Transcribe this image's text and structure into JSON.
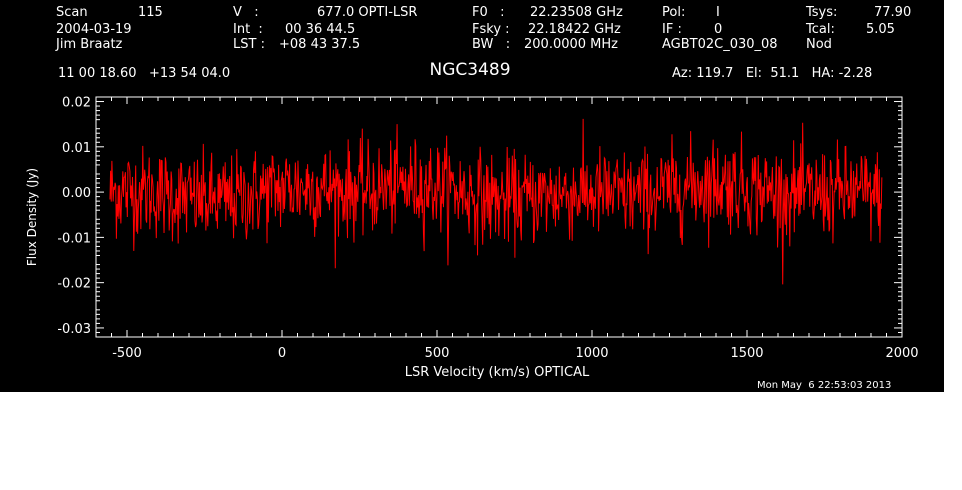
{
  "header": {
    "scan_label": "Scan",
    "scan_value": "115",
    "date": "2004-03-19",
    "observer": "Jim Braatz",
    "v_label": "V   :",
    "v_value": "677.0 OPTI-LSR",
    "int_label": "Int  :",
    "int_value": "00 36 44.5",
    "lst_label": "LST :",
    "lst_value": "+08 43 37.5",
    "f0_label": "F0   :",
    "f0_value": "22.23508 GHz",
    "fsky_label": "Fsky :",
    "fsky_value": "22.18422 GHz",
    "bw_label": "BW   :",
    "bw_value": "200.0000 MHz",
    "pol_label": "Pol:",
    "pol_value": "I",
    "if_label": "IF :",
    "if_value": "0",
    "project": "AGBT02C_030_08",
    "tsys_label": "Tsys:",
    "tsys_value": "77.90",
    "tcal_label": "Tcal:",
    "tcal_value": "5.05",
    "mode": "Nod",
    "coords": "11 00 18.60   +13 54 04.0",
    "az_el_ha": "Az: 119.7   El:  51.1   HA: -2.28",
    "timestamp": "Mon May  6 22:53:03 2013"
  },
  "chart_data": {
    "type": "line",
    "title": "NGC3489",
    "xlabel": "LSR Velocity (km/s) OPTICAL",
    "ylabel": "Flux Density (Jy)",
    "xlim": [
      -600,
      2000
    ],
    "ylim": [
      -0.032,
      0.021
    ],
    "x_ticks": [
      -500,
      0,
      500,
      1000,
      1500,
      2000
    ],
    "x_tick_labels": [
      "-500",
      "0",
      "500",
      "1000",
      "1500",
      "2000"
    ],
    "y_ticks": [
      -0.03,
      -0.02,
      -0.01,
      0.0,
      0.01,
      0.02
    ],
    "y_tick_labels": [
      "-0.03",
      "-0.02",
      "-0.01",
      "0.00",
      "0.01",
      "0.02"
    ],
    "grid": false,
    "series": [
      {
        "color": "#ff0000",
        "x_start": -555,
        "x_end": 1935,
        "points": 1200,
        "mean_y": 0.0,
        "noise_rms_y": 0.005,
        "min_y": -0.022,
        "max_y": 0.017
      }
    ],
    "colors": {
      "background": "#000000",
      "axes": "#ffffff",
      "line": "#ff0000"
    }
  }
}
